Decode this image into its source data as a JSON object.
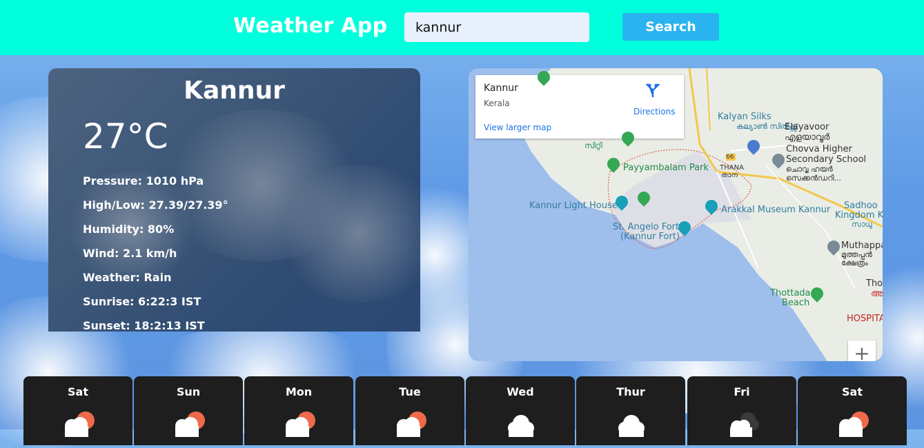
{
  "header": {
    "title": "Weather App",
    "search_value": "kannur",
    "search_button": "Search"
  },
  "current": {
    "city": "Kannur",
    "temperature": "27°C",
    "details": [
      "Pressure: 1010 hPa",
      "High/Low: 27.39/27.39°",
      "Humidity: 80%",
      "Wind: 2.1 km/h",
      "Weather: Rain",
      "Sunrise: 6:22:3 IST",
      "Sunset: 18:2:13 IST"
    ]
  },
  "map": {
    "place_name": "Kannur",
    "place_region": "Kerala",
    "directions_label": "Directions",
    "larger_map_label": "View larger map",
    "zoom_in_label": "+",
    "labels": {
      "kalyan": "Kalyan Silks",
      "kalyan_ml": "കല്യാൺ സിൽക്സ്",
      "elayavoor": "Elayavoor",
      "elayavoor_ml": "എളയാവൂർ",
      "chovva": "Chovva Higher",
      "chovva2": "Secondary School",
      "chovva_ml": "ചൊവ്വ ഹയർ",
      "chovva_ml2": "സെക്കൻഡറി...",
      "payyambalam": "Payyambalam Park",
      "thana": "THANA",
      "thana_ml": "താന",
      "road_66": "66",
      "lighthouse": "Kannur Light House",
      "arakkal": "Arakkal Museum Kannur",
      "sadhoo": "Sadhoo",
      "sadhoo2": "Kingdom K",
      "sadhoo_ml": "സാധു",
      "angelo": "St. Angelo Fort",
      "angelo2": "(Kannur Fort)",
      "muthappa": "Muthappa",
      "muthappa_ml": "മുത്തപ്പൻ",
      "muthappa_ml2": "ക്ഷേത്രം",
      "thottada": "Thottada",
      "beach": "Beach",
      "tho": "Tho",
      "hospital": "HOSPITA",
      "a_ml": "അ",
      "siti": "സിറ്റി"
    }
  },
  "forecast": [
    {
      "day": "Sat",
      "icon": "partly-cloudy-sun-icon"
    },
    {
      "day": "Sun",
      "icon": "partly-cloudy-sun-icon"
    },
    {
      "day": "Mon",
      "icon": "partly-cloudy-sun-icon"
    },
    {
      "day": "Tue",
      "icon": "partly-cloudy-sun-icon"
    },
    {
      "day": "Wed",
      "icon": "cloud-icon"
    },
    {
      "day": "Thur",
      "icon": "cloud-icon"
    },
    {
      "day": "Fri",
      "icon": "dark-clouds-icon"
    },
    {
      "day": "Sat",
      "icon": "partly-cloudy-sun-icon"
    }
  ],
  "colors": {
    "header_bg": "#00ffdd",
    "search_button_bg": "#2ab4ef",
    "forecast_bg": "#1e1e1e",
    "sun": "#ee6a4a"
  }
}
